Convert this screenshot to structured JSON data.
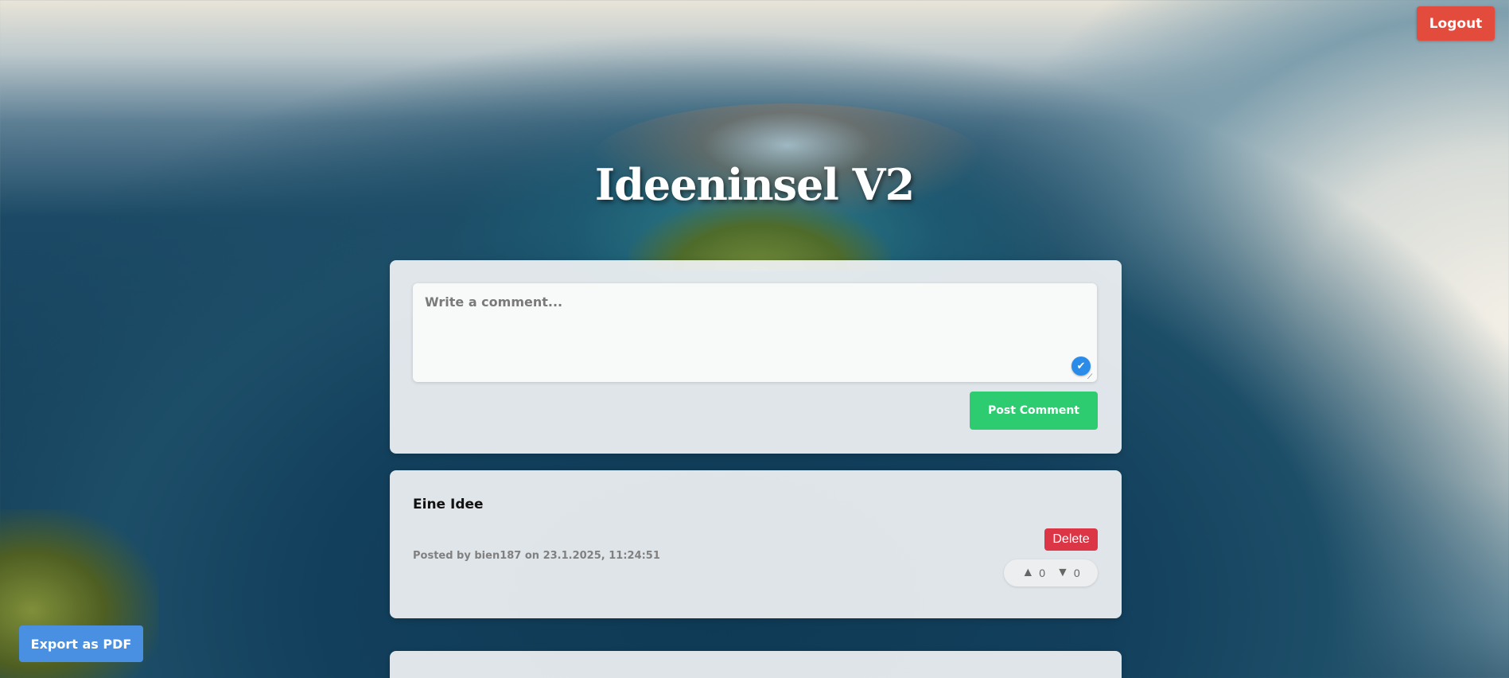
{
  "header": {
    "logout_label": "Logout",
    "title": "Ideeninsel V2"
  },
  "comment_form": {
    "placeholder": "Write a comment...",
    "post_label": "Post Comment"
  },
  "ideas": [
    {
      "title": "Eine Idee",
      "meta": "Posted by bien187 on 23.1.2025, 11:24:51",
      "delete_label": "Delete",
      "upvotes": "0",
      "downvotes": "0"
    }
  ],
  "footer": {
    "export_label": "Export as PDF"
  },
  "icons": {
    "upvote": "triangle-up-icon",
    "downvote": "triangle-down-icon",
    "grammar": "check-circle-icon"
  },
  "colors": {
    "logout": "#e34b3c",
    "post": "#2ecc71",
    "delete": "#dc3545",
    "export": "#4a90e2"
  }
}
